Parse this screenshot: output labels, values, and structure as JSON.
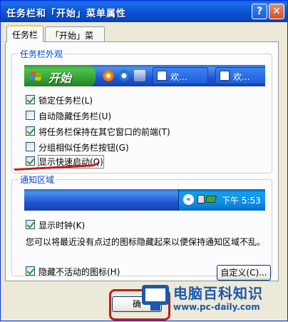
{
  "window": {
    "title": "任务栏和「开始」菜单属性"
  },
  "titlebar_buttons": {
    "help": "?",
    "close": "✕"
  },
  "tabs": [
    {
      "label": "任务栏",
      "active": true
    },
    {
      "label": "「开始」菜单",
      "active": false
    }
  ],
  "taskbar_group": {
    "legend": "任务栏外观",
    "preview": {
      "start_label": "开始",
      "task_buttons": [
        "欢...",
        "欢..."
      ]
    },
    "options": [
      {
        "label": "锁定任务栏(L)",
        "checked": true
      },
      {
        "label": "自动隐藏任务栏(U)",
        "checked": false
      },
      {
        "label": "将任务栏保持在其它窗口的前端(T)",
        "checked": true
      },
      {
        "label": "分组相似任务栏按钮(G)",
        "checked": false
      },
      {
        "label": "显示快速启动(Q)",
        "checked": true
      }
    ]
  },
  "notification_group": {
    "legend": "通知区域",
    "tray": {
      "chevron": "«",
      "time": "下午 5:53"
    },
    "show_clock": {
      "label": "显示时钟(K)",
      "checked": true
    },
    "description": "您可以将最近没有点过的图标隐藏起来以便保持通知区域不乱。",
    "hide_inactive": {
      "label": "隐藏不活动的图标(H)",
      "checked": true
    },
    "customize_label": "自定义(C)..."
  },
  "ok_label": "确",
  "watermark": {
    "title": "电脑百科知识",
    "url": "www.pc-daily.com"
  },
  "colors": {
    "annotation": "#c11b17",
    "titlebar": "#0a5fe6",
    "legend": "#0046d5"
  }
}
